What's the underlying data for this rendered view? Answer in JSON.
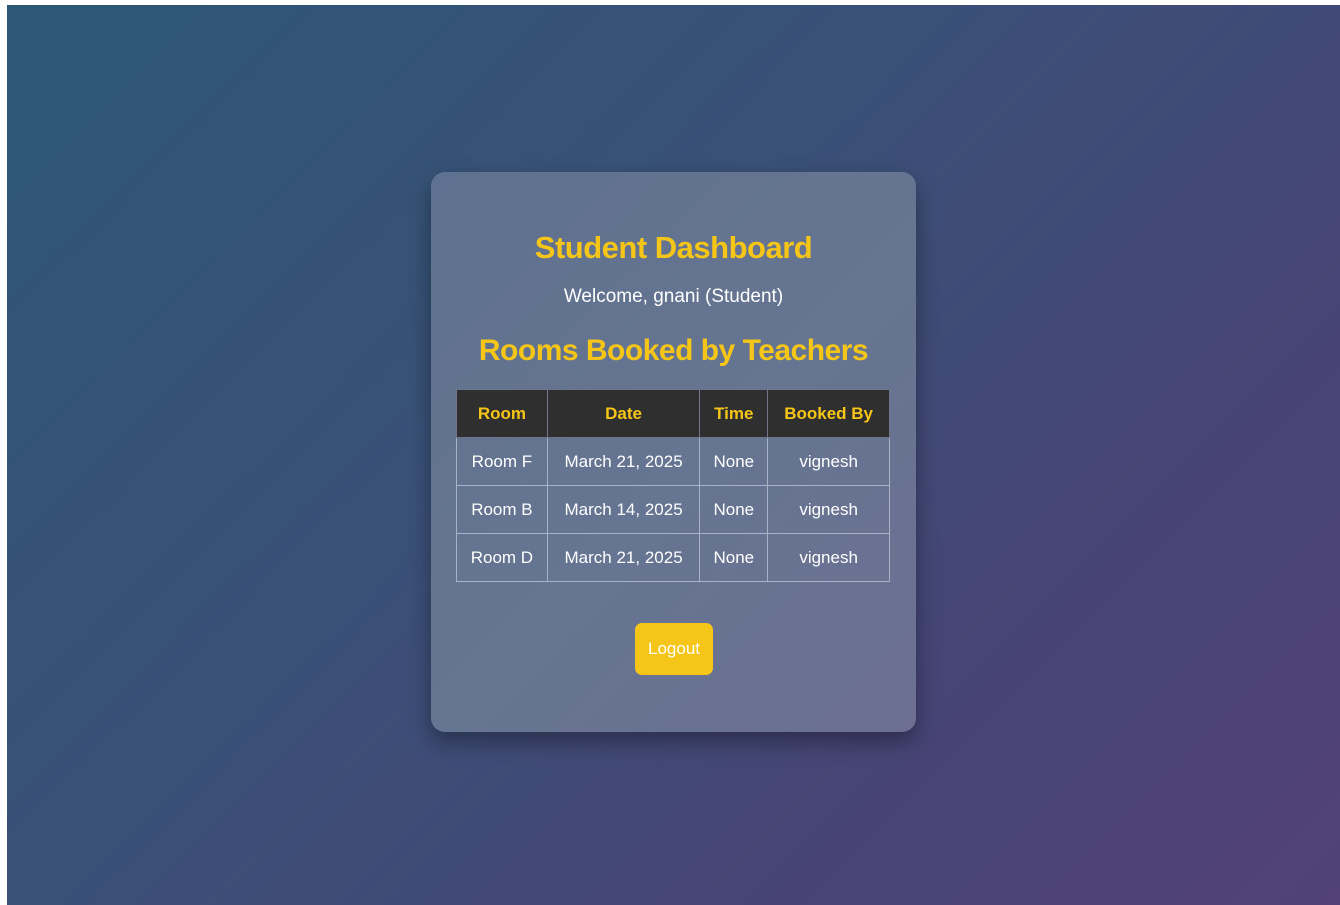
{
  "dashboard": {
    "title": "Student Dashboard",
    "welcome": "Welcome, gnani (Student)",
    "bookings_title": "Rooms Booked by Teachers"
  },
  "table": {
    "headers": [
      "Room",
      "Date",
      "Time",
      "Booked By"
    ],
    "rows": [
      [
        "Room F",
        "March 21, 2025",
        "None",
        "vignesh"
      ],
      [
        "Room B",
        "March 14, 2025",
        "None",
        "vignesh"
      ],
      [
        "Room D",
        "March 21, 2025",
        "None",
        "vignesh"
      ]
    ]
  },
  "actions": {
    "logout_label": "Logout"
  },
  "colors": {
    "accent": "#f5c518",
    "header_bg": "#2f2f2f"
  }
}
